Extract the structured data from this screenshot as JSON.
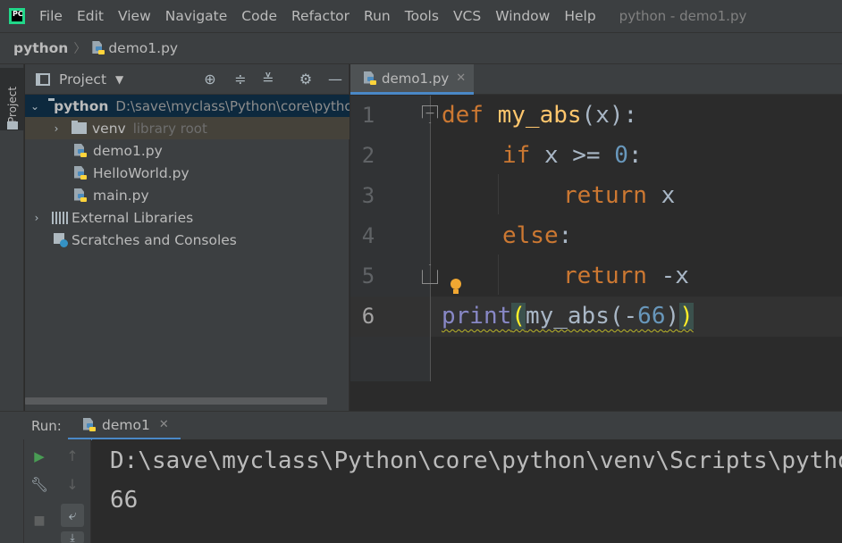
{
  "menubar": {
    "app_icon_label": "PC",
    "items": [
      "File",
      "Edit",
      "View",
      "Navigate",
      "Code",
      "Refactor",
      "Run",
      "Tools",
      "VCS",
      "Window",
      "Help"
    ],
    "window_title": "python - demo1.py"
  },
  "breadcrumb": {
    "project": "python",
    "file": "demo1.py"
  },
  "left_strip": {
    "project_label": "Project"
  },
  "project_panel": {
    "title": "Project",
    "tree": {
      "root_name": "python",
      "root_path": "D:\\save\\myclass\\Python\\core\\python",
      "venv_name": "venv",
      "venv_tag": "library root",
      "files": [
        "demo1.py",
        "HelloWorld.py",
        "main.py"
      ],
      "external_libraries": "External Libraries",
      "scratches": "Scratches and Consoles"
    }
  },
  "editor": {
    "tab_label": "demo1.py",
    "line_numbers": [
      "1",
      "2",
      "3",
      "4",
      "5",
      "6"
    ],
    "current_line": 6,
    "code": {
      "line1": {
        "kw": "def",
        "fn": "my_abs",
        "rest": "(x):"
      },
      "line2": {
        "kw": "if",
        "rest": " x >= ",
        "num": "0",
        "tail": ":"
      },
      "line3": {
        "kw": "return",
        "rest": " x"
      },
      "line4": {
        "kw": "else",
        "tail": ":"
      },
      "line5": {
        "kw": "return",
        "rest": " -x"
      },
      "line6": {
        "builtin": "print",
        "open": "(",
        "middle": "my_abs(-",
        "num": "66",
        "close_inner": ")",
        "close": ")"
      }
    }
  },
  "run_panel": {
    "label": "Run:",
    "tab_label": "demo1",
    "output": [
      "D:\\save\\myclass\\Python\\core\\python\\venv\\Scripts\\python.exe",
      "66"
    ]
  }
}
